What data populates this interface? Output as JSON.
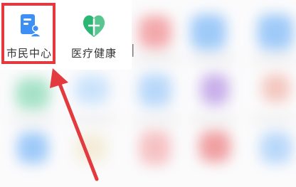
{
  "apps": [
    {
      "label": "市民中心",
      "icon": "citizen-center-icon",
      "color": "#3d8ff5",
      "highlighted": true
    },
    {
      "label": "医疗健康",
      "icon": "medical-health-icon",
      "color": "#2bb673",
      "highlighted": false
    }
  ],
  "colors": {
    "highlight": "#e23a3f",
    "arrow": "#e23a3f"
  }
}
